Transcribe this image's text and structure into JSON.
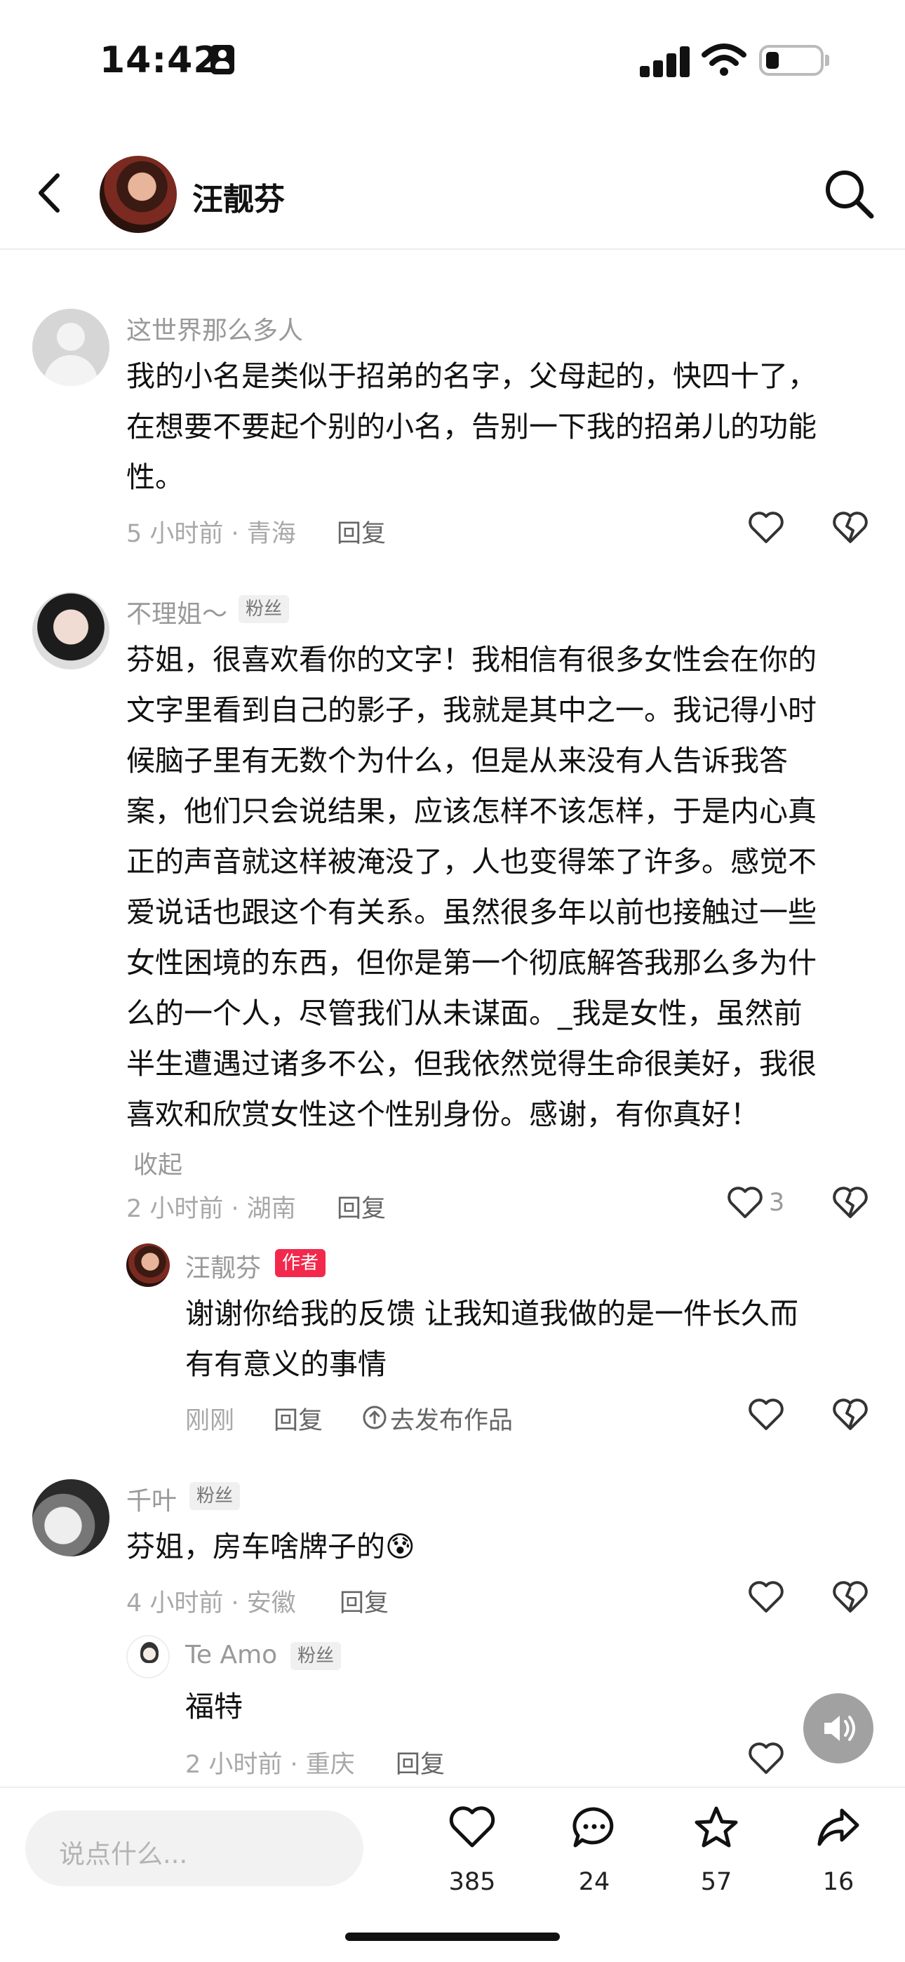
{
  "status_bar": {
    "time": "14:42"
  },
  "header": {
    "title": "汪靓芬"
  },
  "comments": [
    {
      "user": "这世界那么多人",
      "lines": [
        "我的小名是类似于招弟的名字，父母起的，快四十了，",
        "在想要不要起个别的小名，告别一下我的招弟儿的功能",
        "性。"
      ],
      "meta": "5 小时前 · 青海",
      "reply": "回复"
    },
    {
      "user": "不理姐～",
      "badge": "粉丝",
      "lines": [
        "芬姐，很喜欢看你的文字！我相信有很多女性会在你的",
        "文字里看到自己的影子，我就是其中之一。我记得小时",
        "候脑子里有无数个为什么，但是从来没有人告诉我答",
        "案，他们只会说结果，应该怎样不该怎样，于是内心真",
        "正的声音就这样被淹没了，人也变得笨了许多。感觉不",
        "爱说话也跟这个有关系。虽然很多年以前也接触过一些",
        "女性困境的东西，但你是第一个彻底解答我那么多为什",
        "么的一个人，尽管我们从未谋面。_我是女性，虽然前",
        "半生遭遇过诸多不公，但我依然觉得生命很美好，我很",
        "喜欢和欣赏女性这个性别身份。感谢，有你真好！"
      ],
      "collapse": "收起",
      "meta": "2 小时前 · 湖南",
      "reply": "回复",
      "likes": "3",
      "reply_item": {
        "user": "汪靓芬",
        "badge": "作者",
        "lines": [
          "谢谢你给我的反馈 让我知道我做的是一件长久而",
          "有有意义的事情"
        ],
        "meta": "刚刚",
        "reply": "回复",
        "publish": "去发布作品"
      }
    },
    {
      "user": "千叶",
      "badge": "粉丝",
      "lines": [
        "芬姐，房车啥牌子的😰"
      ],
      "meta": "4 小时前 · 安徽",
      "reply": "回复",
      "reply_item": {
        "user": "Te Amo",
        "badge": "粉丝",
        "lines": [
          "福特"
        ],
        "meta": "2 小时前 · 重庆",
        "reply": "回复"
      }
    }
  ],
  "bottom_bar": {
    "placeholder": "说点什么...",
    "likes": "385",
    "comments": "24",
    "favorites": "57",
    "shares": "16"
  },
  "icons": [
    "back-icon",
    "search-icon",
    "like-icon",
    "dislike-icon",
    "speaker-icon",
    "comment-icon",
    "star-icon",
    "share-icon"
  ]
}
